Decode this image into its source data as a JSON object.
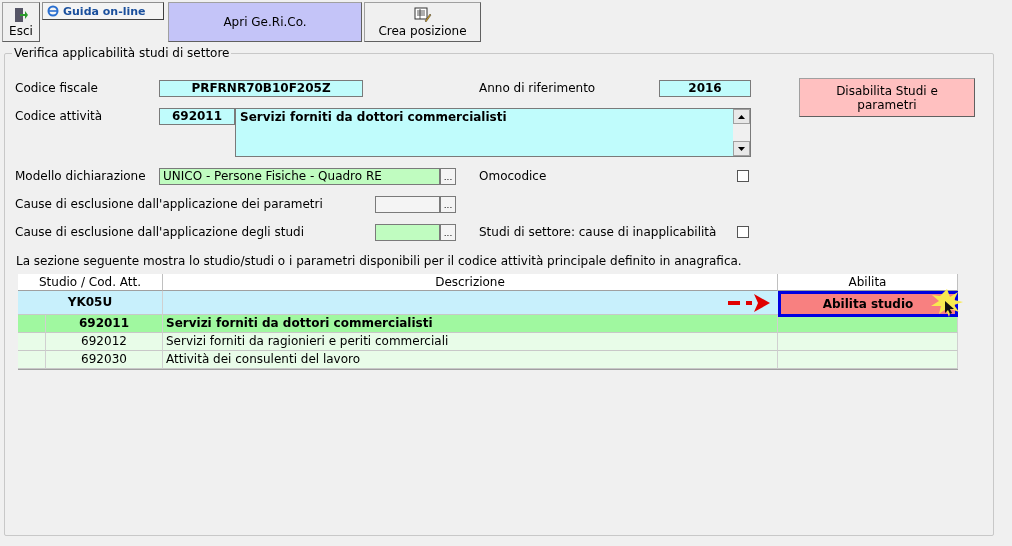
{
  "toolbar": [
    {
      "kind": "door",
      "label": "Esci"
    },
    {
      "kind": "link",
      "label": "Guida on-line"
    },
    {
      "kind": "highlight",
      "label": "Apri Ge.Ri.Co."
    },
    {
      "kind": "note",
      "label": "Crea posizione"
    }
  ],
  "group": {
    "title": "Verifica applicabilità studi di settore"
  },
  "codice_fiscale": {
    "label": "Codice fiscale",
    "value": "PRFRNR70B10F205Z"
  },
  "anno": {
    "label": "Anno di riferimento",
    "value": "2016"
  },
  "codice_attivita": {
    "label": "Codice attività",
    "code": "692011",
    "description": "Servizi forniti da dottori commercialisti"
  },
  "modello": {
    "label": "Modello dichiarazione",
    "value": "UNICO - Persone Fisiche - Quadro RE",
    "ellipsis": "..."
  },
  "omocodice": {
    "label": "Omocodice",
    "checked": false
  },
  "cause_parametri": {
    "label": "Cause di esclusione dall'applicazione dei parametri",
    "ellipsis": "..."
  },
  "cause_studi": {
    "label": "Cause di esclusione dall'applicazione degli studi",
    "ellipsis": "..."
  },
  "inapplicabilita": {
    "label": "Studi di settore: cause di inapplicabilità",
    "checked": false
  },
  "disable_button": {
    "label": "Disabilita Studi e parametri"
  },
  "note": "La sezione seguente mostra lo studio/studi o i parametri disponibili per il codice attività principale definito in anagrafica.",
  "table": {
    "columns": [
      "Studio / Cod. Att.",
      "Descrizione",
      "Abilita"
    ],
    "rows": [
      {
        "kind": "study",
        "code": "YK05U",
        "action": "Abilita studio"
      },
      {
        "kind": "activity",
        "code": "692011",
        "description": "Servizi forniti da dottori commercialisti",
        "selected": true
      },
      {
        "kind": "activity",
        "code": "692012",
        "description": "Servizi forniti da ragionieri e periti commerciali",
        "selected": false
      },
      {
        "kind": "activity",
        "code": "692030",
        "description": "Attività dei consulenti del lavoro",
        "selected": false
      }
    ]
  }
}
